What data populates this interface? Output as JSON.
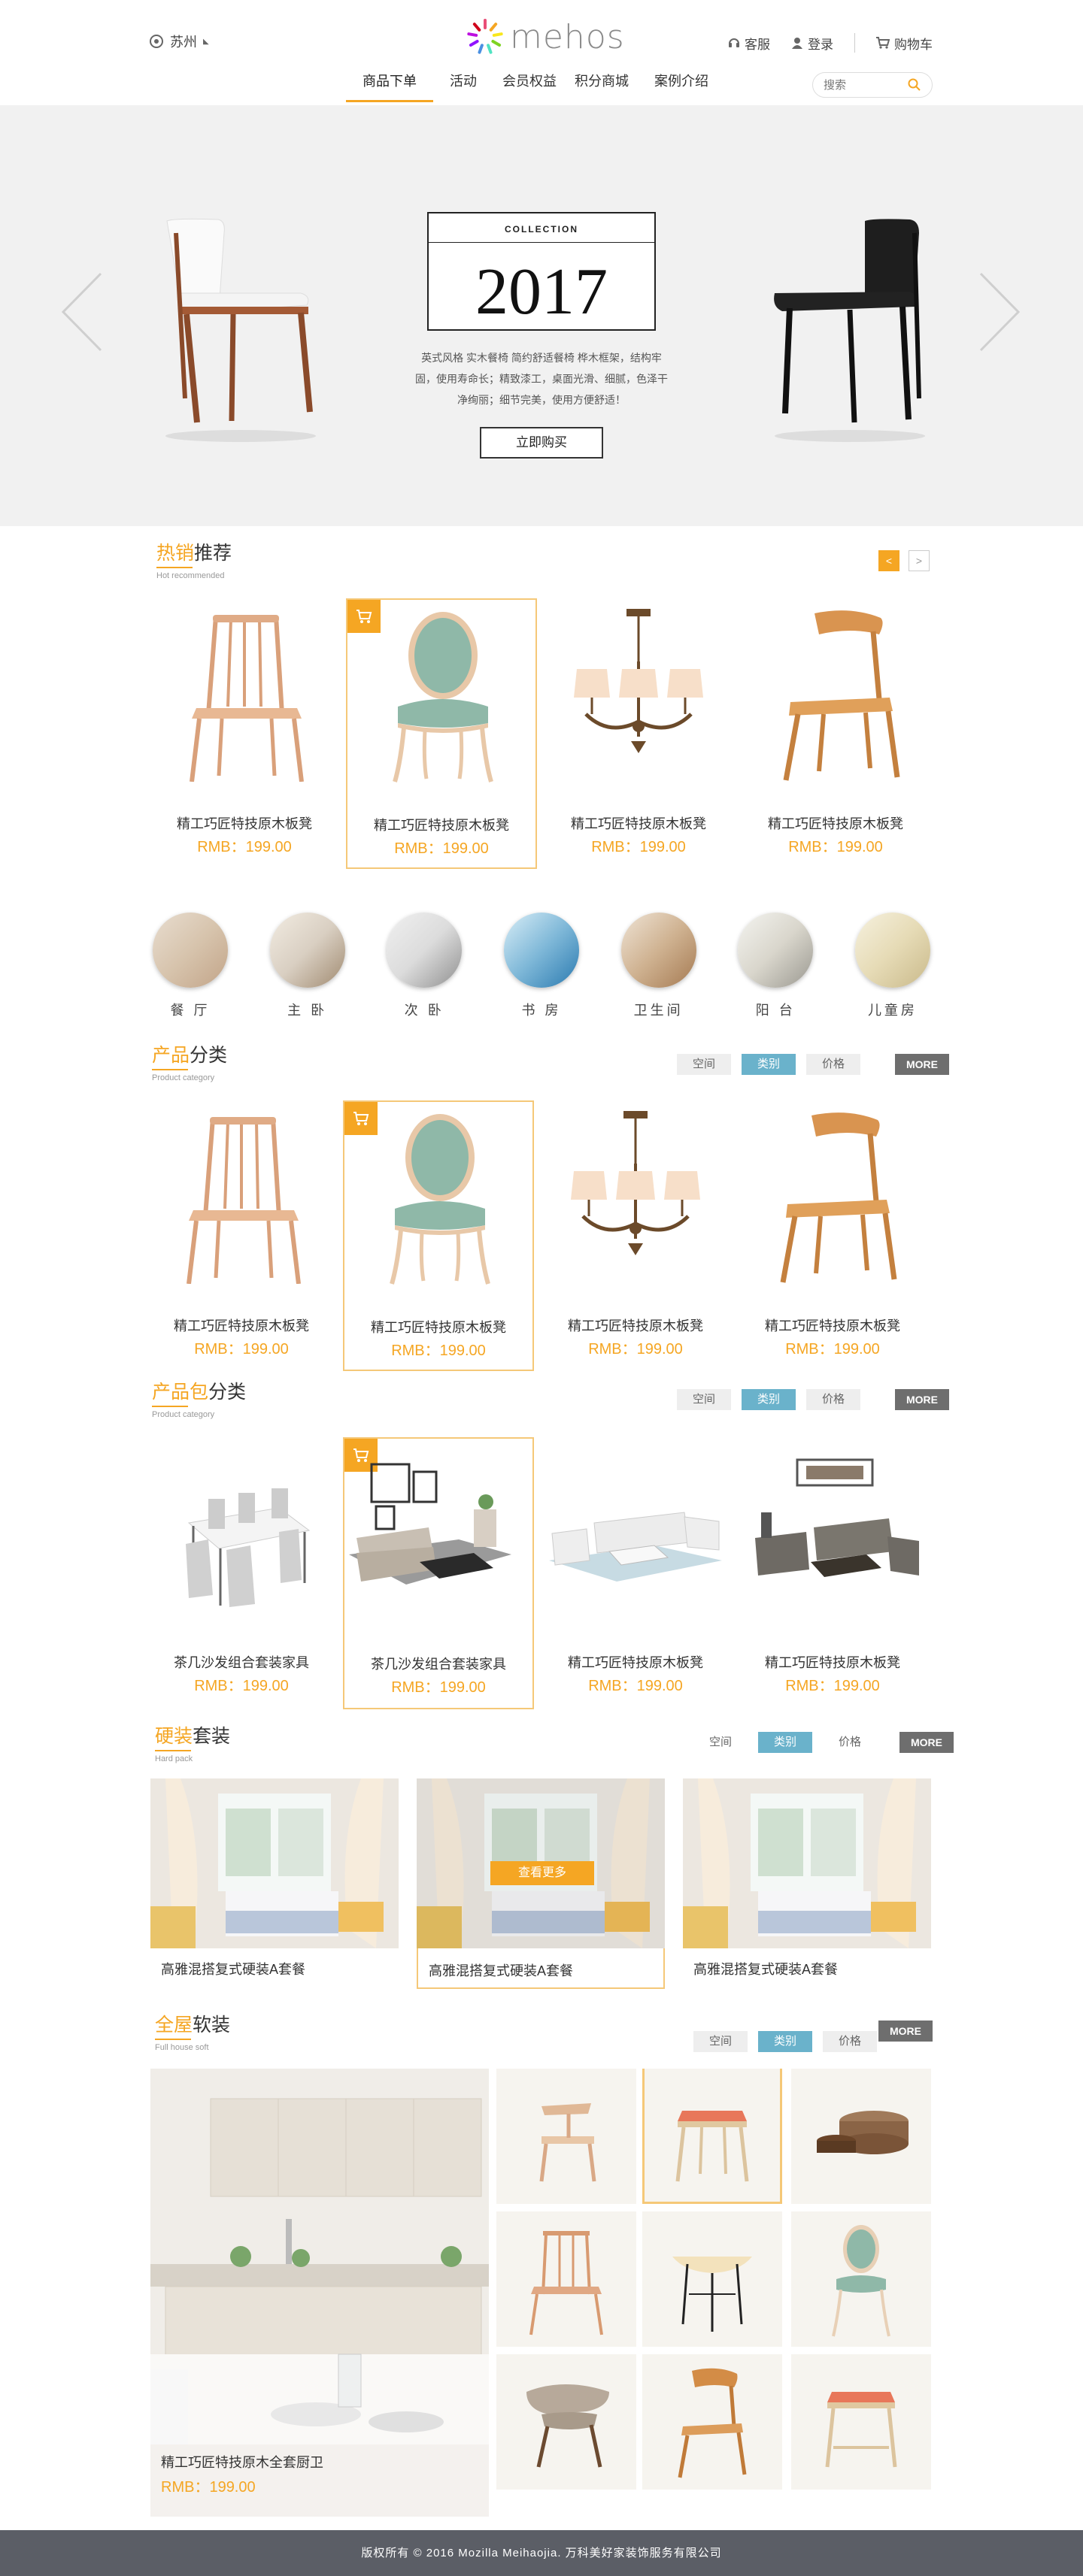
{
  "header": {
    "location": "苏州",
    "logo": "mehos",
    "links": {
      "service": "客服",
      "login": "登录",
      "cart": "购物车"
    },
    "nav": [
      "商品下单",
      "活动",
      "会员权益",
      "积分商城",
      "案例介绍"
    ],
    "search_placeholder": "搜索"
  },
  "banner": {
    "collection_label": "COLLECTION",
    "year": "2017",
    "desc_lines": [
      "英式风格 实木餐椅 简约舒适餐椅 桦木框架，结构牢",
      "固，使用寿命长；精致漆工，桌面光滑、细腻，色泽干",
      "净绚丽；细节完美，使用方便舒适！"
    ],
    "buy_label": "立即购买"
  },
  "hot": {
    "title_hi": "热销",
    "title_rest": "推荐",
    "subtitle": "Hot recommended",
    "products": [
      {
        "name": "精工巧匠特技原木板凳",
        "price": "RMB：199.00"
      },
      {
        "name": "精工巧匠特技原木板凳",
        "price": "RMB：199.00"
      },
      {
        "name": "精工巧匠特技原木板凳",
        "price": "RMB：199.00"
      },
      {
        "name": "精工巧匠特技原木板凳",
        "price": "RMB：199.00"
      }
    ]
  },
  "rooms": [
    "餐 厅",
    "主 卧",
    "次 卧",
    "书 房",
    "卫生间",
    "阳 台",
    "儿童房"
  ],
  "category": {
    "title_hi": "产品",
    "title_rest": "分类",
    "subtitle": "Product category",
    "filters": [
      "空间",
      "类别",
      "价格"
    ],
    "more": "MORE",
    "products": [
      {
        "name": "精工巧匠特技原木板凳",
        "price": "RMB：199.00"
      },
      {
        "name": "精工巧匠特技原木板凳",
        "price": "RMB：199.00"
      },
      {
        "name": "精工巧匠特技原木板凳",
        "price": "RMB：199.00"
      },
      {
        "name": "精工巧匠特技原木板凳",
        "price": "RMB：199.00"
      }
    ]
  },
  "package": {
    "title_hi": "产品包",
    "title_rest": "分类",
    "subtitle": "Product category",
    "filters": [
      "空间",
      "类别",
      "价格"
    ],
    "more": "MORE",
    "products": [
      {
        "name": "茶几沙发组合套装家具",
        "price": "RMB：199.00"
      },
      {
        "name": "茶几沙发组合套装家具",
        "price": "RMB：199.00"
      },
      {
        "name": "精工巧匠特技原木板凳",
        "price": "RMB：199.00"
      },
      {
        "name": "精工巧匠特技原木板凳",
        "price": "RMB：199.00"
      }
    ]
  },
  "hard": {
    "title_hi": "硬装",
    "title_rest": "套装",
    "subtitle": "Hard pack",
    "filters": [
      "空间",
      "类别",
      "价格"
    ],
    "more": "MORE",
    "see_more": "查看更多",
    "suites": [
      "高雅混搭复式硬装A套餐",
      "高雅混搭复式硬装A套餐",
      "高雅混搭复式硬装A套餐"
    ]
  },
  "soft": {
    "title_hi": "全屋",
    "title_rest": "软装",
    "subtitle": "Full house soft",
    "filters": [
      "空间",
      "类别",
      "价格"
    ],
    "more": "MORE",
    "feature_name": "精工巧匠特技原木全套厨卫",
    "feature_price": "RMB：199.00"
  },
  "footer": "版权所有 © 2016 Mozilla Meihaojia. 万科美好家装饰服务有限公司",
  "colors": {
    "accent": "#f5a623",
    "filter_on": "#6ab2cb",
    "footer": "#5b5e66"
  }
}
